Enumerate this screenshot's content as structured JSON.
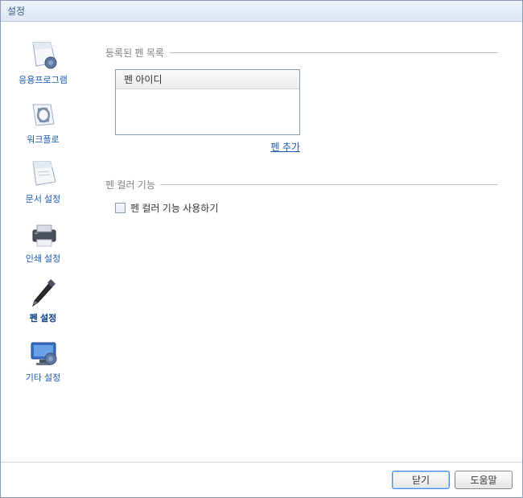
{
  "window": {
    "title": "설정"
  },
  "sidebar": {
    "items": [
      {
        "label": "응용프로그램",
        "icon": "app"
      },
      {
        "label": "워크플로",
        "icon": "workflow"
      },
      {
        "label": "문서 설정",
        "icon": "document"
      },
      {
        "label": "인쇄 설정",
        "icon": "printer"
      },
      {
        "label": "펜 설정",
        "icon": "pen"
      },
      {
        "label": "기타 설정",
        "icon": "monitor"
      }
    ],
    "selected_index": 4
  },
  "main": {
    "section1": {
      "title": "등록된 펜 목록",
      "list_header": "펜 아이디",
      "add_link": "펜 추가"
    },
    "section2": {
      "title": "펜 컬러 기능",
      "checkbox_label": "펜 컬러 기능 사용하기",
      "checkbox_checked": false
    }
  },
  "footer": {
    "close": "닫기",
    "help": "도움말"
  }
}
